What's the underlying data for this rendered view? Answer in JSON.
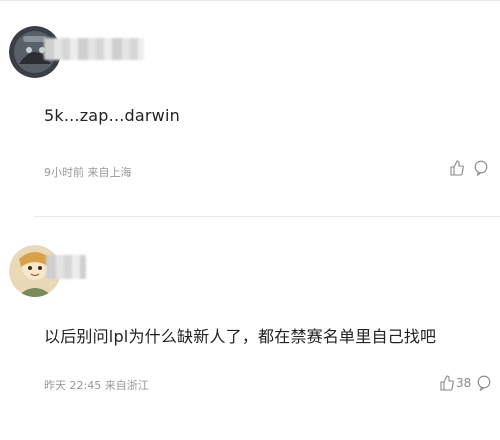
{
  "comments": [
    {
      "content": "5k...zap...darwin",
      "meta": "9小时前 来自上海",
      "like_count": "",
      "avatar_icon": "dark-avatar-icon",
      "username_redacted": true
    },
    {
      "content": "以后别问lpl为什么缺新人了，都在禁赛名单里自己找吧",
      "meta": "昨天 22:45 来自浙江",
      "like_count": "38",
      "avatar_icon": "cartoon-avatar-icon",
      "username_redacted": true
    }
  ],
  "colors": {
    "text": "#222222",
    "meta": "#999999",
    "icon": "#888888",
    "divider": "#e8e8e8"
  }
}
